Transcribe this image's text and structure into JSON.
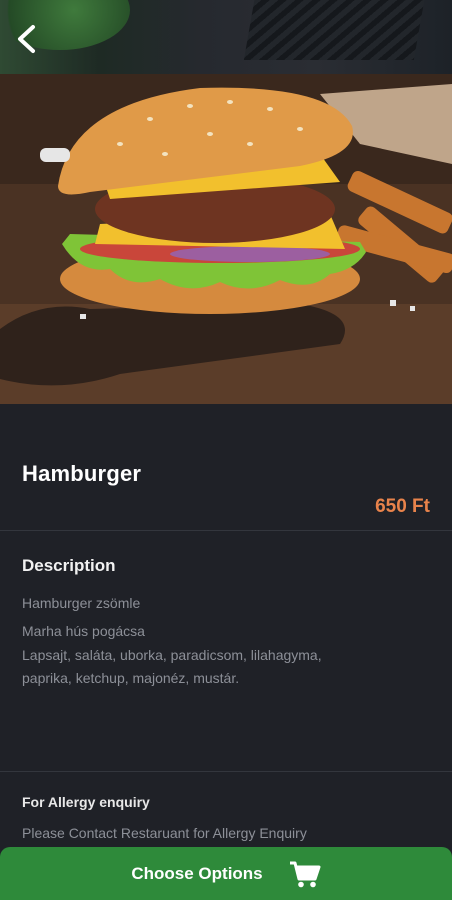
{
  "header": {
    "back_icon": "chevron-left-icon"
  },
  "product": {
    "name": "Hamburger",
    "price": "650 Ft",
    "image": "hamburger-photo"
  },
  "description": {
    "heading": "Description",
    "lines": [
      "Hamburger zsömle",
      "Marha hús pogácsa",
      "Lapsajt, saláta, uborka, paradicsom, lilahagyma,",
      "paprika, ketchup, majonéz, mustár."
    ]
  },
  "allergy": {
    "heading": "For Allergy enquiry",
    "text": "Please Contact Restaruant for Allergy Enquiry"
  },
  "footer": {
    "button_label": "Choose Options",
    "cart_icon": "cart-icon"
  },
  "colors": {
    "background": "#1f2127",
    "price": "#e8834b",
    "button": "#2e8a3a"
  }
}
